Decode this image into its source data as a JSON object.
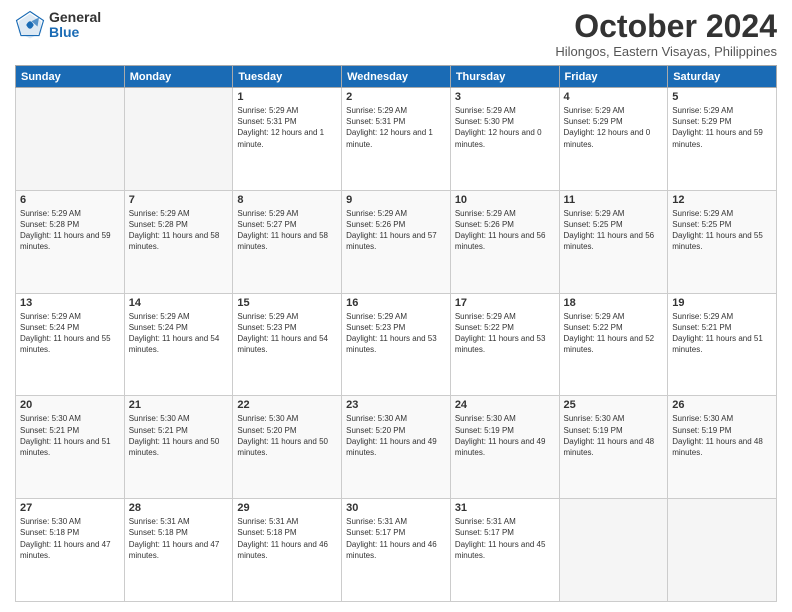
{
  "logo": {
    "text_general": "General",
    "text_blue": "Blue"
  },
  "title": "October 2024",
  "location": "Hilongos, Eastern Visayas, Philippines",
  "weekdays": [
    "Sunday",
    "Monday",
    "Tuesday",
    "Wednesday",
    "Thursday",
    "Friday",
    "Saturday"
  ],
  "weeks": [
    [
      {
        "day": "",
        "empty": true
      },
      {
        "day": "",
        "empty": true
      },
      {
        "day": "1",
        "sunrise": "5:29 AM",
        "sunset": "5:31 PM",
        "daylight": "12 hours and 1 minute."
      },
      {
        "day": "2",
        "sunrise": "5:29 AM",
        "sunset": "5:31 PM",
        "daylight": "12 hours and 1 minute."
      },
      {
        "day": "3",
        "sunrise": "5:29 AM",
        "sunset": "5:30 PM",
        "daylight": "12 hours and 0 minutes."
      },
      {
        "day": "4",
        "sunrise": "5:29 AM",
        "sunset": "5:29 PM",
        "daylight": "12 hours and 0 minutes."
      },
      {
        "day": "5",
        "sunrise": "5:29 AM",
        "sunset": "5:29 PM",
        "daylight": "11 hours and 59 minutes."
      }
    ],
    [
      {
        "day": "6",
        "sunrise": "5:29 AM",
        "sunset": "5:28 PM",
        "daylight": "11 hours and 59 minutes."
      },
      {
        "day": "7",
        "sunrise": "5:29 AM",
        "sunset": "5:28 PM",
        "daylight": "11 hours and 58 minutes."
      },
      {
        "day": "8",
        "sunrise": "5:29 AM",
        "sunset": "5:27 PM",
        "daylight": "11 hours and 58 minutes."
      },
      {
        "day": "9",
        "sunrise": "5:29 AM",
        "sunset": "5:26 PM",
        "daylight": "11 hours and 57 minutes."
      },
      {
        "day": "10",
        "sunrise": "5:29 AM",
        "sunset": "5:26 PM",
        "daylight": "11 hours and 56 minutes."
      },
      {
        "day": "11",
        "sunrise": "5:29 AM",
        "sunset": "5:25 PM",
        "daylight": "11 hours and 56 minutes."
      },
      {
        "day": "12",
        "sunrise": "5:29 AM",
        "sunset": "5:25 PM",
        "daylight": "11 hours and 55 minutes."
      }
    ],
    [
      {
        "day": "13",
        "sunrise": "5:29 AM",
        "sunset": "5:24 PM",
        "daylight": "11 hours and 55 minutes."
      },
      {
        "day": "14",
        "sunrise": "5:29 AM",
        "sunset": "5:24 PM",
        "daylight": "11 hours and 54 minutes."
      },
      {
        "day": "15",
        "sunrise": "5:29 AM",
        "sunset": "5:23 PM",
        "daylight": "11 hours and 54 minutes."
      },
      {
        "day": "16",
        "sunrise": "5:29 AM",
        "sunset": "5:23 PM",
        "daylight": "11 hours and 53 minutes."
      },
      {
        "day": "17",
        "sunrise": "5:29 AM",
        "sunset": "5:22 PM",
        "daylight": "11 hours and 53 minutes."
      },
      {
        "day": "18",
        "sunrise": "5:29 AM",
        "sunset": "5:22 PM",
        "daylight": "11 hours and 52 minutes."
      },
      {
        "day": "19",
        "sunrise": "5:29 AM",
        "sunset": "5:21 PM",
        "daylight": "11 hours and 51 minutes."
      }
    ],
    [
      {
        "day": "20",
        "sunrise": "5:30 AM",
        "sunset": "5:21 PM",
        "daylight": "11 hours and 51 minutes."
      },
      {
        "day": "21",
        "sunrise": "5:30 AM",
        "sunset": "5:21 PM",
        "daylight": "11 hours and 50 minutes."
      },
      {
        "day": "22",
        "sunrise": "5:30 AM",
        "sunset": "5:20 PM",
        "daylight": "11 hours and 50 minutes."
      },
      {
        "day": "23",
        "sunrise": "5:30 AM",
        "sunset": "5:20 PM",
        "daylight": "11 hours and 49 minutes."
      },
      {
        "day": "24",
        "sunrise": "5:30 AM",
        "sunset": "5:19 PM",
        "daylight": "11 hours and 49 minutes."
      },
      {
        "day": "25",
        "sunrise": "5:30 AM",
        "sunset": "5:19 PM",
        "daylight": "11 hours and 48 minutes."
      },
      {
        "day": "26",
        "sunrise": "5:30 AM",
        "sunset": "5:19 PM",
        "daylight": "11 hours and 48 minutes."
      }
    ],
    [
      {
        "day": "27",
        "sunrise": "5:30 AM",
        "sunset": "5:18 PM",
        "daylight": "11 hours and 47 minutes."
      },
      {
        "day": "28",
        "sunrise": "5:31 AM",
        "sunset": "5:18 PM",
        "daylight": "11 hours and 47 minutes."
      },
      {
        "day": "29",
        "sunrise": "5:31 AM",
        "sunset": "5:18 PM",
        "daylight": "11 hours and 46 minutes."
      },
      {
        "day": "30",
        "sunrise": "5:31 AM",
        "sunset": "5:17 PM",
        "daylight": "11 hours and 46 minutes."
      },
      {
        "day": "31",
        "sunrise": "5:31 AM",
        "sunset": "5:17 PM",
        "daylight": "11 hours and 45 minutes."
      },
      {
        "day": "",
        "empty": true
      },
      {
        "day": "",
        "empty": true
      }
    ]
  ]
}
